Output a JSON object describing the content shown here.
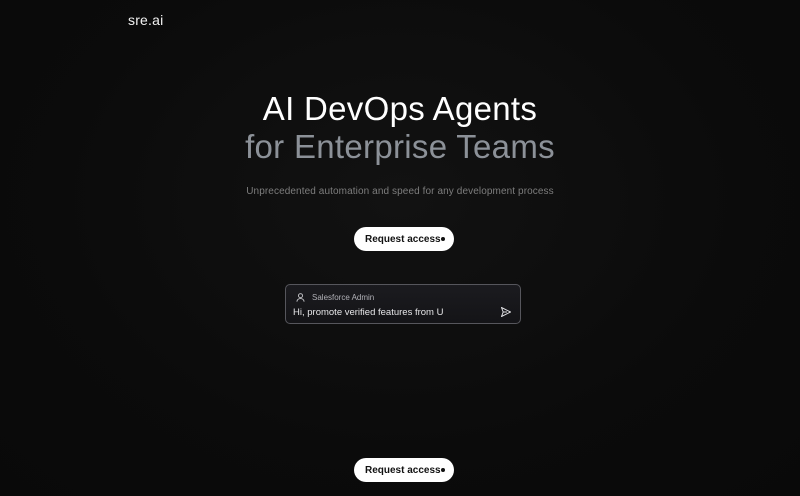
{
  "header": {
    "logo": "sre.ai"
  },
  "hero": {
    "headline_line1": "AI DevOps Agents",
    "headline_line2": "for Enterprise Teams",
    "subtitle": "Unprecedented automation and speed for any development process",
    "cta_label": "Request access"
  },
  "chat": {
    "user_label": "Salesforce Admin",
    "message": "Hi, promote verified features from U",
    "user_icon": "user-icon",
    "send_icon": "send-icon"
  },
  "footer_cta": {
    "label": "Request access"
  },
  "colors": {
    "background": "#0b0b0b",
    "headline_primary": "#ffffff",
    "headline_secondary": "#8c9198",
    "button_bg": "#ffffff",
    "button_text": "#111111"
  }
}
